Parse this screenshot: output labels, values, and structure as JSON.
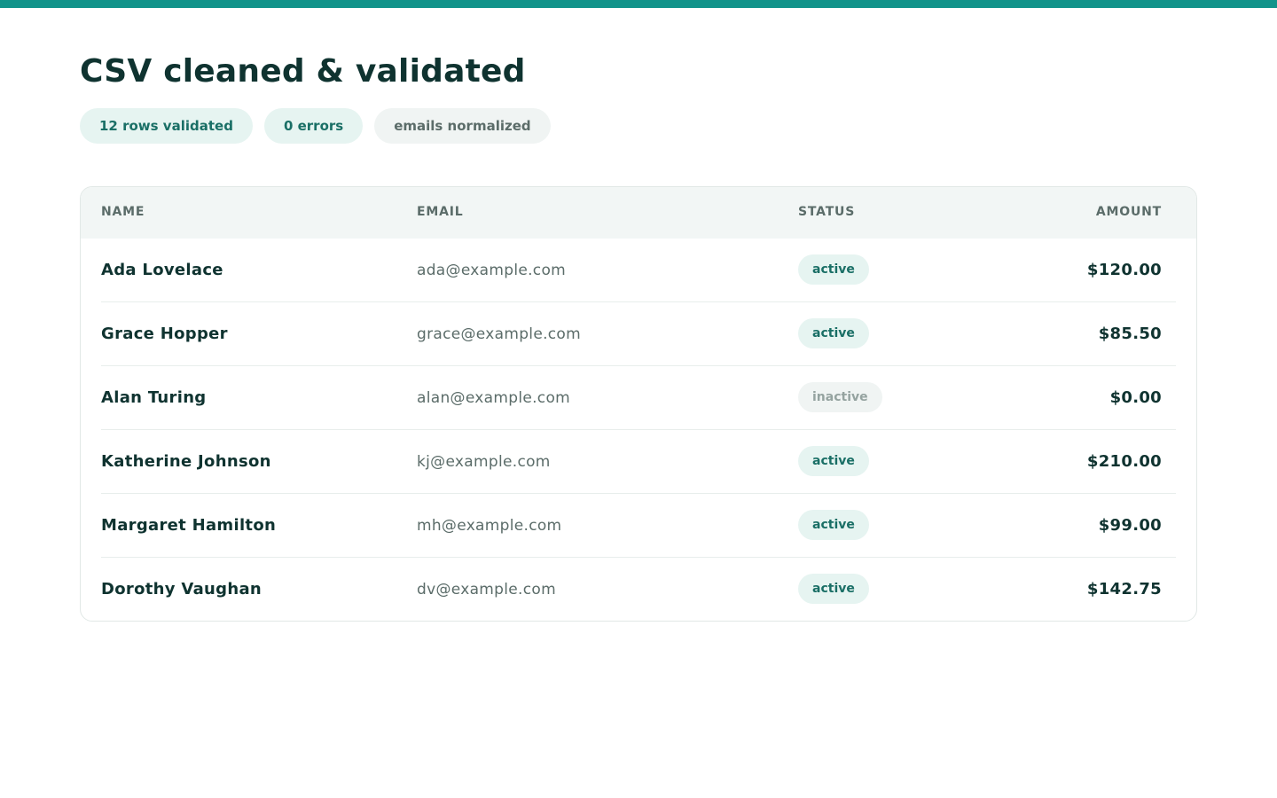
{
  "page": {
    "title": "CSV cleaned & validated",
    "accent_color": "#11938a"
  },
  "chips": [
    {
      "label": "12 rows validated",
      "variant": "accent"
    },
    {
      "label": "0 errors",
      "variant": "accent"
    },
    {
      "label": "emails normalized",
      "variant": "muted"
    }
  ],
  "table": {
    "headers": {
      "name": "NAME",
      "email": "EMAIL",
      "status": "STATUS",
      "amount": "AMOUNT"
    },
    "rows": [
      {
        "name": "Ada Lovelace",
        "email": "ada@example.com",
        "status": "active",
        "amount": "$120.00"
      },
      {
        "name": "Grace Hopper",
        "email": "grace@example.com",
        "status": "active",
        "amount": "$85.50"
      },
      {
        "name": "Alan Turing",
        "email": "alan@example.com",
        "status": "inactive",
        "amount": "$0.00"
      },
      {
        "name": "Katherine Johnson",
        "email": "kj@example.com",
        "status": "active",
        "amount": "$210.00"
      },
      {
        "name": "Margaret Hamilton",
        "email": "mh@example.com",
        "status": "active",
        "amount": "$99.00"
      },
      {
        "name": "Dorothy Vaughan",
        "email": "dv@example.com",
        "status": "active",
        "amount": "$142.75"
      }
    ]
  }
}
